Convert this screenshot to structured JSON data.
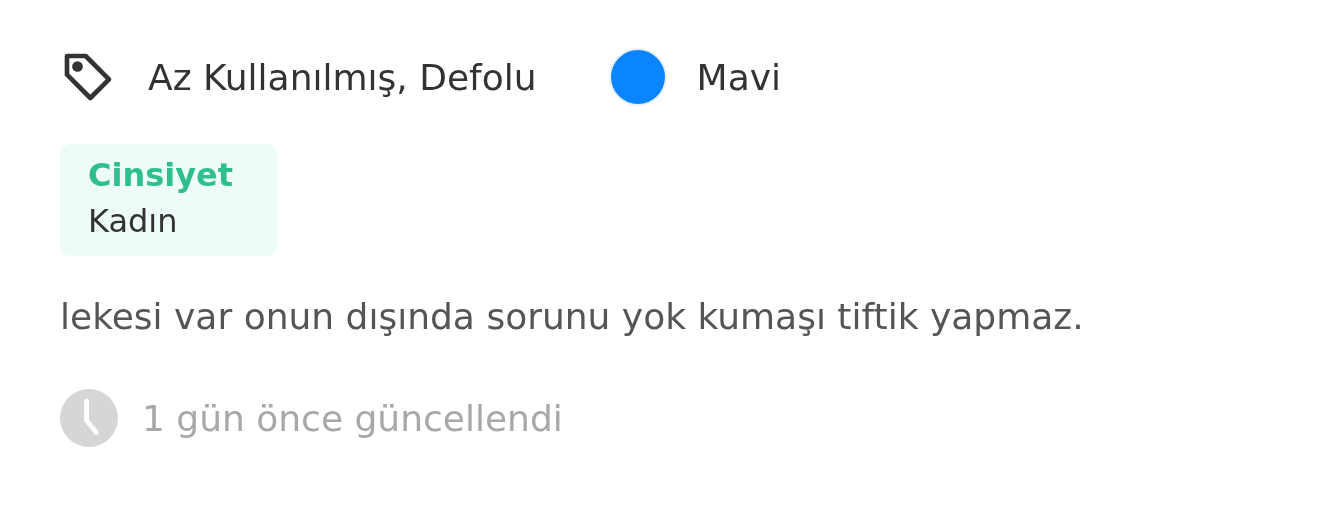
{
  "condition": {
    "label": "Az Kullanılmış, Defolu"
  },
  "colour": {
    "name": "Mavi",
    "color": "#0a84ff"
  },
  "attribute": {
    "label": "Cinsiyet",
    "value": "Kadın"
  },
  "description": "lekesi var onun dışında sorunu yok kumaşı tiftik yapmaz.",
  "updated": "1 gün önce güncellendi"
}
